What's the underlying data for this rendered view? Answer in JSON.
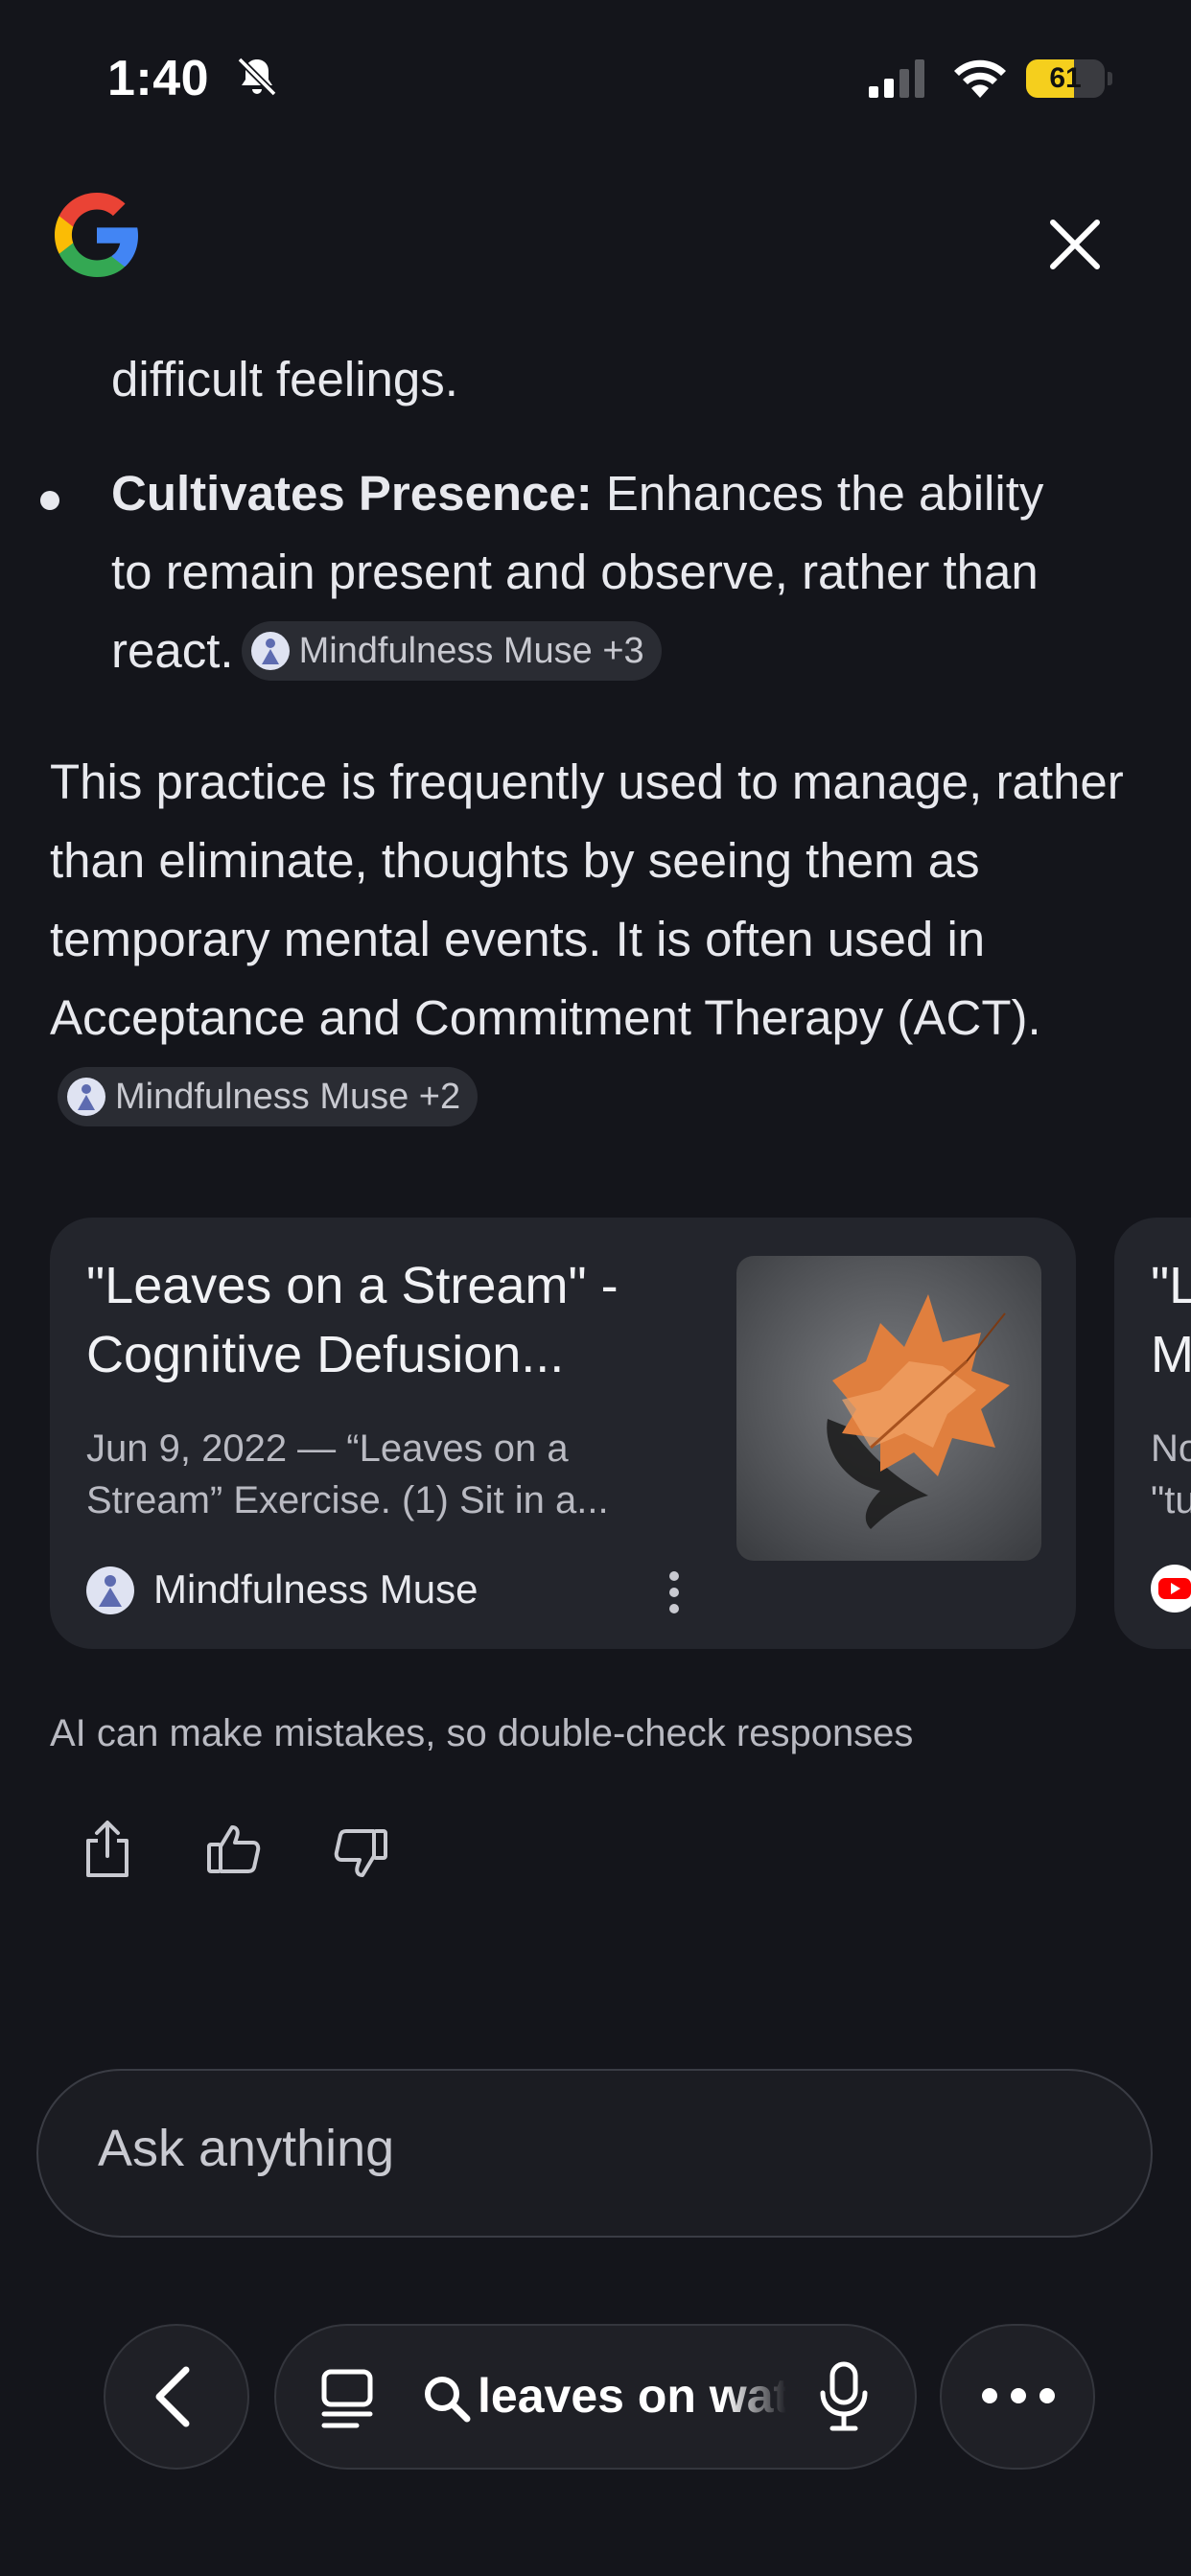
{
  "status_bar": {
    "time": "1:40",
    "battery": "61",
    "battery_fraction": 0.61,
    "battery_color": "#f5cf1d",
    "icons": [
      "bell-slash-icon",
      "cellular-signal-icon",
      "wifi-icon",
      "battery-icon"
    ]
  },
  "header": {
    "logo": "google-g-logo",
    "close_icon": "close-icon"
  },
  "answer": {
    "continued_text": "difficult feelings.",
    "bullet": {
      "title": "Cultivates Presence:",
      "text": " Enhances the ability to remain present and observe, rather than react.",
      "source_chip": "Mindfulness Muse +3"
    },
    "paragraph": {
      "text": "This practice is frequently used to manage, rather than eliminate, thoughts by seeing them as temporary mental events. It is often used in Acceptance and Commitment Therapy (ACT).",
      "source_chip": "Mindfulness Muse +2"
    }
  },
  "result_cards": [
    {
      "title": "\"Leaves on a Stream\" - Cognitive Defusion...",
      "snippet": "Jun 9, 2022 — “Leaves on a Stream” Exercise. (1) Sit in a...",
      "source": "Mindfulness Muse",
      "thumbnail": "autumn-leaf-on-water-image"
    },
    {
      "title_line1": "\"L",
      "title_line2": "M",
      "snippet_line1": "No",
      "snippet_line2": "\"tu",
      "source_icon": "youtube-icon"
    }
  ],
  "disclaimer": "AI can make mistakes, so double-check responses",
  "feedback": {
    "icons": [
      "share-icon",
      "thumbs-up-icon",
      "thumbs-down-icon"
    ]
  },
  "ask": {
    "placeholder": "Ask anything"
  },
  "bottom_nav": {
    "query": "leaves on water",
    "icons": [
      "back-arrow-icon",
      "tabs-icon",
      "search-icon",
      "microphone-icon",
      "more-icon"
    ]
  },
  "colors": {
    "background": "#14151b",
    "card": "#23252c",
    "chip": "#2a2c33",
    "text": "#e8e9ee",
    "muted": "#b9bac2"
  }
}
